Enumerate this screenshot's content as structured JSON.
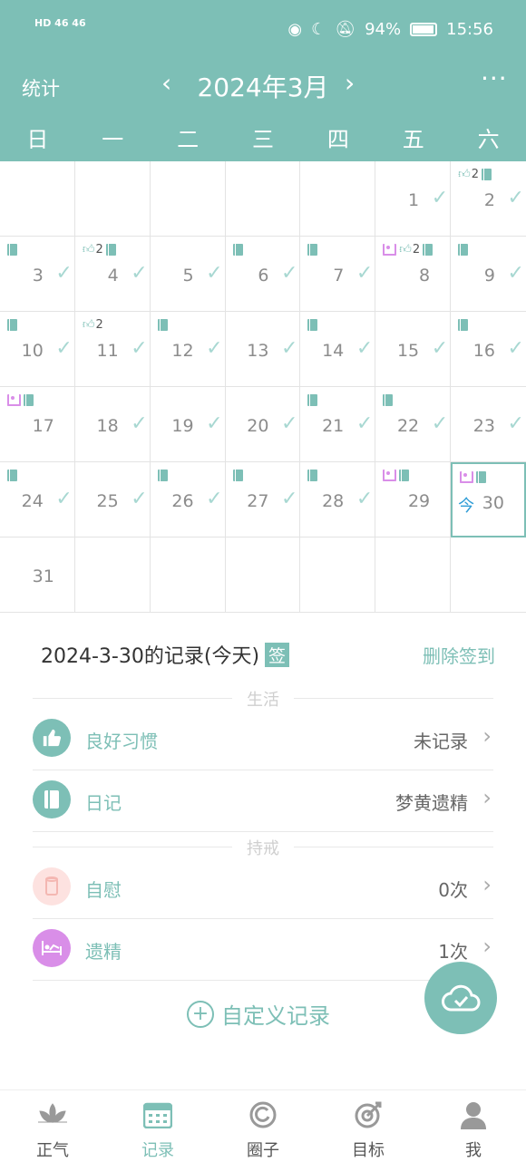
{
  "status_bar": {
    "network_left": "HD 46 46",
    "battery": "94%",
    "time": "15:56",
    "icons": [
      "signal-icon",
      "wifi-icon",
      "eye-icon",
      "moon-icon",
      "mute-icon",
      "battery-icon"
    ]
  },
  "header": {
    "left_label": "统计",
    "month": "2024年3月",
    "prev_icon": "chevron-left-icon",
    "next_icon": "chevron-right-icon",
    "more_icon": "more-icon"
  },
  "weekdays": [
    "日",
    "一",
    "二",
    "三",
    "四",
    "五",
    "六"
  ],
  "today_label": "今",
  "calendar": [
    {
      "day": "",
      "check": false,
      "icons": []
    },
    {
      "day": "",
      "check": false,
      "icons": []
    },
    {
      "day": "",
      "check": false,
      "icons": []
    },
    {
      "day": "",
      "check": false,
      "icons": []
    },
    {
      "day": "",
      "check": false,
      "icons": []
    },
    {
      "day": "1",
      "check": true,
      "icons": []
    },
    {
      "day": "2",
      "check": true,
      "icons": [
        "like:2",
        "diary"
      ]
    },
    {
      "day": "3",
      "check": true,
      "icons": [
        "diary"
      ]
    },
    {
      "day": "4",
      "check": true,
      "icons": [
        "like:2",
        "diary"
      ]
    },
    {
      "day": "5",
      "check": true,
      "icons": []
    },
    {
      "day": "6",
      "check": true,
      "icons": [
        "diary"
      ]
    },
    {
      "day": "7",
      "check": true,
      "icons": [
        "diary"
      ]
    },
    {
      "day": "8",
      "check": false,
      "icons": [
        "bed",
        "like:2",
        "diary"
      ]
    },
    {
      "day": "9",
      "check": true,
      "icons": [
        "diary"
      ]
    },
    {
      "day": "10",
      "check": true,
      "icons": [
        "diary"
      ]
    },
    {
      "day": "11",
      "check": true,
      "icons": [
        "like:2"
      ]
    },
    {
      "day": "12",
      "check": true,
      "icons": [
        "diary"
      ]
    },
    {
      "day": "13",
      "check": true,
      "icons": []
    },
    {
      "day": "14",
      "check": true,
      "icons": [
        "diary"
      ]
    },
    {
      "day": "15",
      "check": true,
      "icons": []
    },
    {
      "day": "16",
      "check": true,
      "icons": [
        "diary"
      ]
    },
    {
      "day": "17",
      "check": false,
      "icons": [
        "bed",
        "diary"
      ]
    },
    {
      "day": "18",
      "check": true,
      "icons": []
    },
    {
      "day": "19",
      "check": true,
      "icons": []
    },
    {
      "day": "20",
      "check": true,
      "icons": []
    },
    {
      "day": "21",
      "check": true,
      "icons": [
        "diary"
      ]
    },
    {
      "day": "22",
      "check": true,
      "icons": [
        "diary"
      ]
    },
    {
      "day": "23",
      "check": true,
      "icons": []
    },
    {
      "day": "24",
      "check": true,
      "icons": [
        "diary"
      ]
    },
    {
      "day": "25",
      "check": true,
      "icons": []
    },
    {
      "day": "26",
      "check": true,
      "icons": [
        "diary"
      ]
    },
    {
      "day": "27",
      "check": true,
      "icons": [
        "diary"
      ]
    },
    {
      "day": "28",
      "check": true,
      "icons": [
        "diary"
      ]
    },
    {
      "day": "29",
      "check": false,
      "icons": [
        "bed",
        "diary"
      ]
    },
    {
      "day": "30",
      "check": false,
      "icons": [
        "bed",
        "diary"
      ],
      "today": true
    },
    {
      "day": "31",
      "check": false,
      "icons": []
    },
    {
      "day": "",
      "check": false,
      "icons": []
    },
    {
      "day": "",
      "check": false,
      "icons": []
    },
    {
      "day": "",
      "check": false,
      "icons": []
    },
    {
      "day": "",
      "check": false,
      "icons": []
    },
    {
      "day": "",
      "check": false,
      "icons": []
    },
    {
      "day": "",
      "check": false,
      "icons": []
    }
  ],
  "records": {
    "title": "2024-3-30的记录(今天)",
    "sign_badge": "签",
    "delete_sign": "删除签到",
    "section_life": "生活",
    "section_abstain": "持戒",
    "items": [
      {
        "label": "良好习惯",
        "value": "未记录",
        "icon": "thumbs-up-icon",
        "color": "#7dbfb6"
      },
      {
        "label": "日记",
        "value": "梦黄遗精",
        "icon": "diary-icon",
        "color": "#7dbfb6"
      },
      {
        "label": "自慰",
        "value": "0次",
        "icon": "cup-icon",
        "color": "#fde2e0"
      },
      {
        "label": "遗精",
        "value": "1次",
        "icon": "bed-icon",
        "color": "#d98ee8"
      }
    ],
    "custom_label": "自定义记录"
  },
  "fab_icon": "cloud-check-icon",
  "tabs": [
    {
      "label": "正气",
      "icon": "lotus-icon",
      "active": false
    },
    {
      "label": "记录",
      "icon": "calendar-icon",
      "active": true
    },
    {
      "label": "圈子",
      "icon": "circle-icon",
      "active": false
    },
    {
      "label": "目标",
      "icon": "target-icon",
      "active": false
    },
    {
      "label": "我",
      "icon": "user-icon",
      "active": false
    }
  ],
  "colors": {
    "accent": "#7dbfb6",
    "today_tag": "#2e9cd6",
    "bed": "#d98ee8",
    "check": "#a8d8d2"
  }
}
